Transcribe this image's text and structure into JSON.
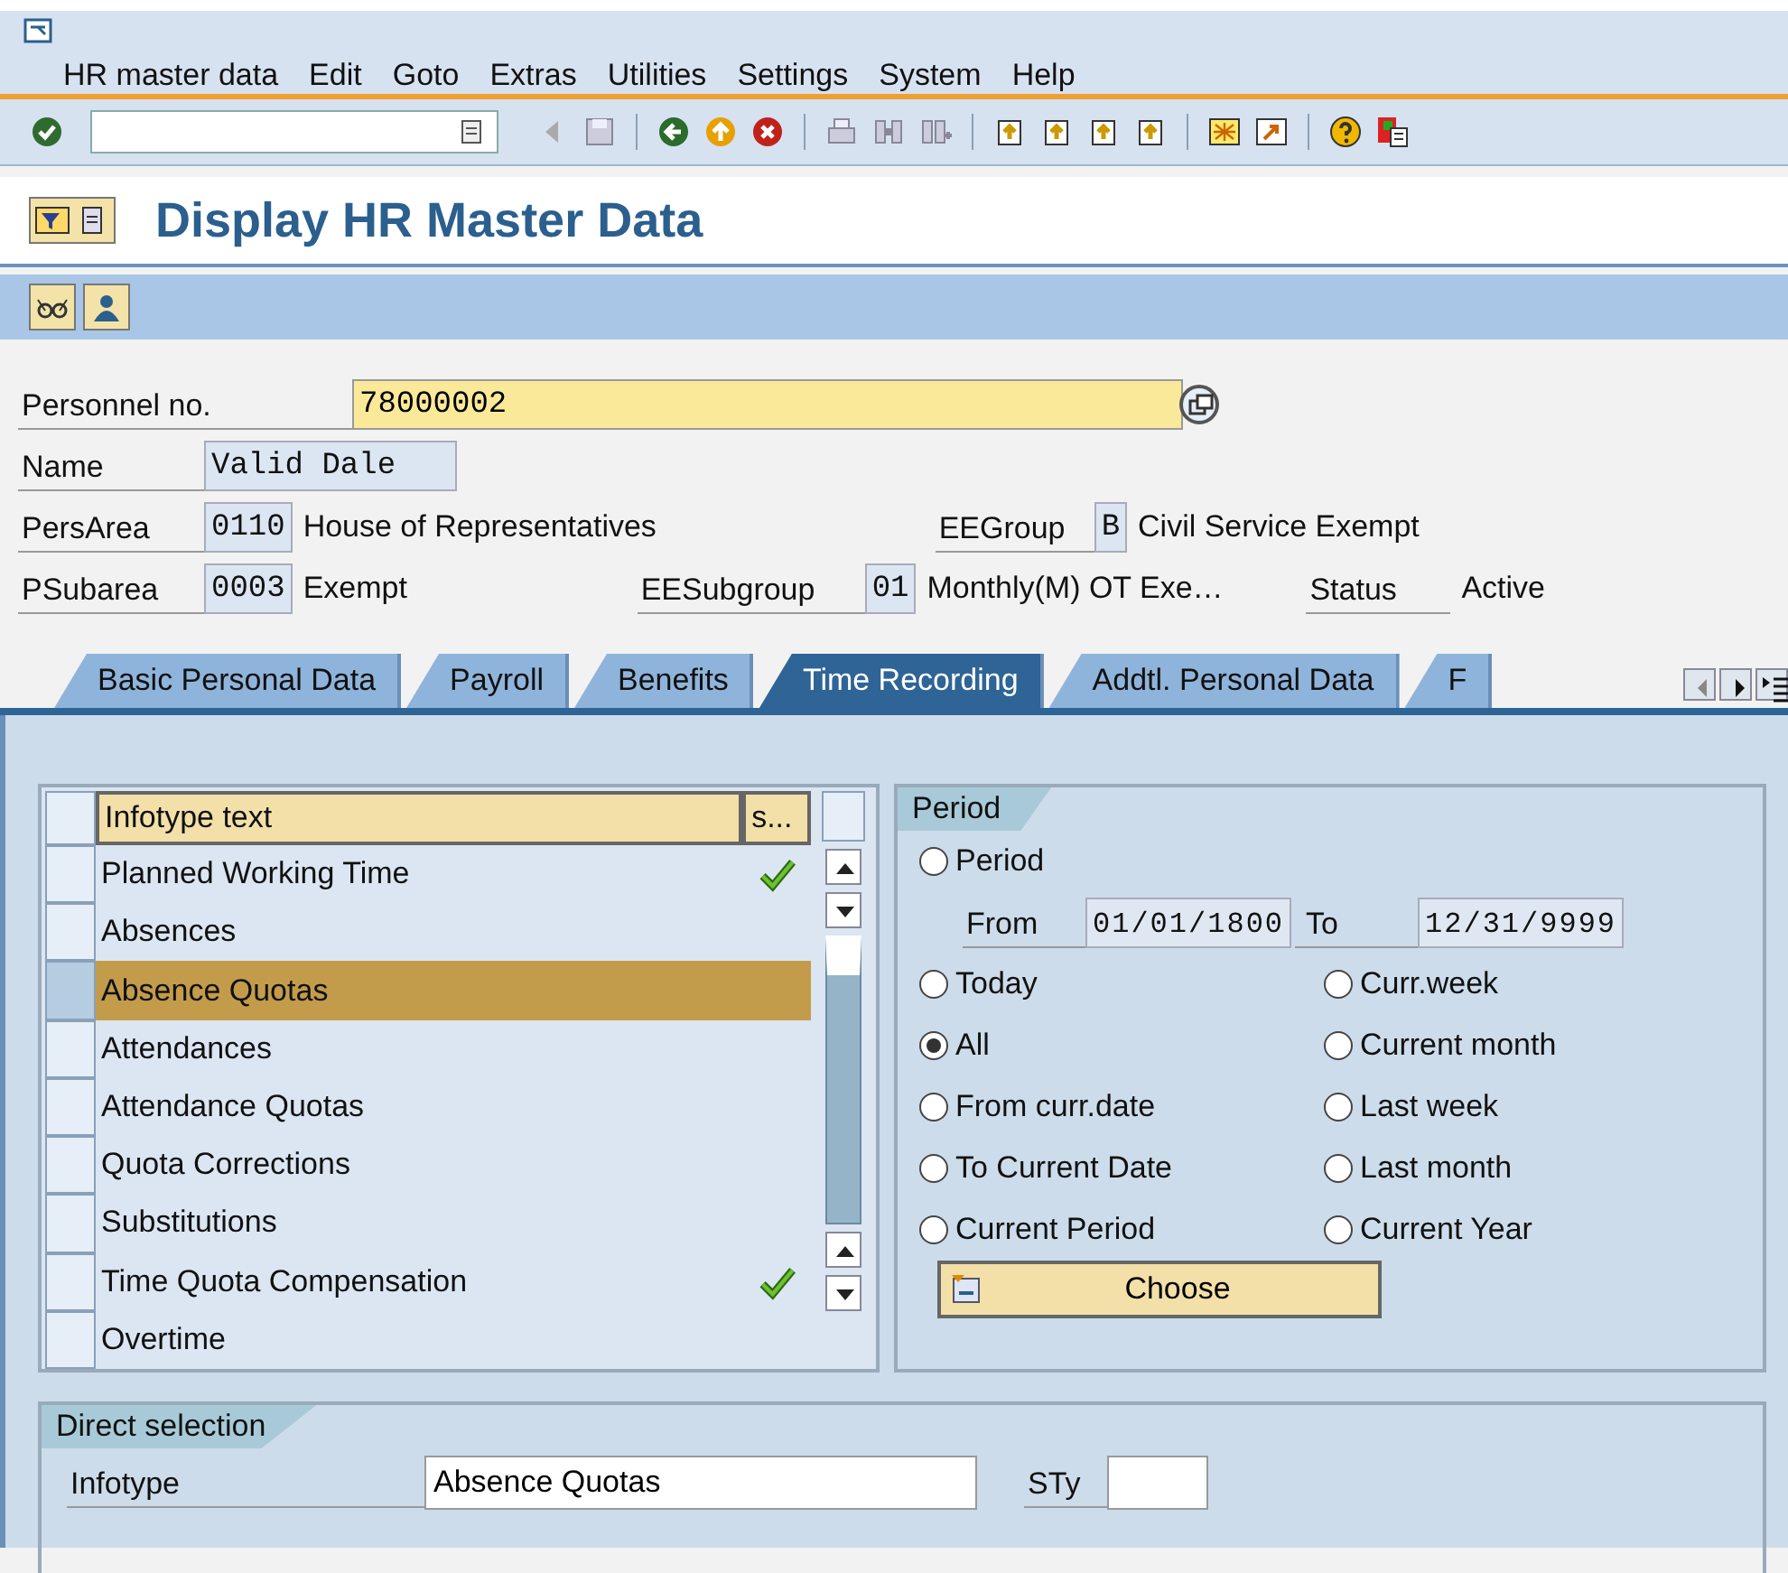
{
  "menu_bar": [
    "HR master data",
    "Edit",
    "Goto",
    "Extras",
    "Utilities",
    "Settings",
    "System",
    "Help"
  ],
  "title": "Display HR Master Data",
  "header": {
    "personnel_no": {
      "label": "Personnel no.",
      "value": "78000002"
    },
    "name": {
      "label": "Name",
      "value": "Valid Dale"
    },
    "pers_area": {
      "label": "PersArea",
      "value": "0110",
      "text": "House of Representatives"
    },
    "ee_group": {
      "label": "EEGroup",
      "value": "B",
      "text": "Civil Service Exempt"
    },
    "p_subarea": {
      "label": "PSubarea",
      "value": "0003",
      "text": "Exempt"
    },
    "ee_subgroup": {
      "label": "EESubgroup",
      "value": "01",
      "text": "Monthly(M) OT Exe…"
    },
    "status": {
      "label": "Status",
      "text": "Active"
    }
  },
  "tabs": [
    {
      "label": "Basic Personal Data",
      "selected": false
    },
    {
      "label": "Payroll",
      "selected": false
    },
    {
      "label": "Benefits",
      "selected": false
    },
    {
      "label": "Time Recording",
      "selected": true
    },
    {
      "label": "Addtl. Personal Data",
      "selected": false
    },
    {
      "label": "F",
      "selected": false
    }
  ],
  "infotype_table": {
    "columns": [
      "Infotype text",
      "s..."
    ],
    "rows": [
      {
        "text": "Planned Working Time",
        "checked": true,
        "selected": false
      },
      {
        "text": "Absences",
        "checked": false,
        "selected": false
      },
      {
        "text": "Absence Quotas",
        "checked": false,
        "selected": true
      },
      {
        "text": "Attendances",
        "checked": false,
        "selected": false
      },
      {
        "text": "Attendance Quotas",
        "checked": false,
        "selected": false
      },
      {
        "text": "Quota Corrections",
        "checked": false,
        "selected": false
      },
      {
        "text": "Substitutions",
        "checked": false,
        "selected": false
      },
      {
        "text": "Time Quota Compensation",
        "checked": true,
        "selected": false
      },
      {
        "text": "Overtime",
        "checked": false,
        "selected": false
      }
    ]
  },
  "period": {
    "title": "Period",
    "period_option": {
      "label": "Period",
      "selected": false
    },
    "from": {
      "label": "From",
      "value": "01/01/1800"
    },
    "to": {
      "label": "To",
      "value": "12/31/9999"
    },
    "options": [
      {
        "label": "Today",
        "selected": false
      },
      {
        "label": "Curr.week",
        "selected": false
      },
      {
        "label": "All",
        "selected": true
      },
      {
        "label": "Current month",
        "selected": false
      },
      {
        "label": "From curr.date",
        "selected": false
      },
      {
        "label": "Last week",
        "selected": false
      },
      {
        "label": "To Current Date",
        "selected": false
      },
      {
        "label": "Last month",
        "selected": false
      },
      {
        "label": "Current Period",
        "selected": false
      },
      {
        "label": "Current Year",
        "selected": false
      }
    ],
    "button": "Choose"
  },
  "direct_selection": {
    "title": "Direct selection",
    "infotype": {
      "label": "Infotype",
      "value": "Absence Quotas"
    },
    "sty": {
      "label": "STy"
    }
  }
}
